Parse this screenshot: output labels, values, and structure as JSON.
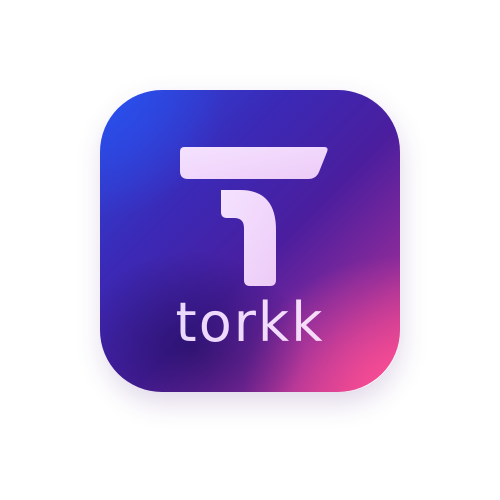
{
  "logo": {
    "wordmark": "torkk",
    "glyph_name": "t-letter-mark",
    "colors": {
      "gradient_blue": "#2c4be0",
      "gradient_purple": "#4a1e9e",
      "gradient_pink": "#e6408a",
      "mark_light": "#f3d9ff"
    }
  }
}
